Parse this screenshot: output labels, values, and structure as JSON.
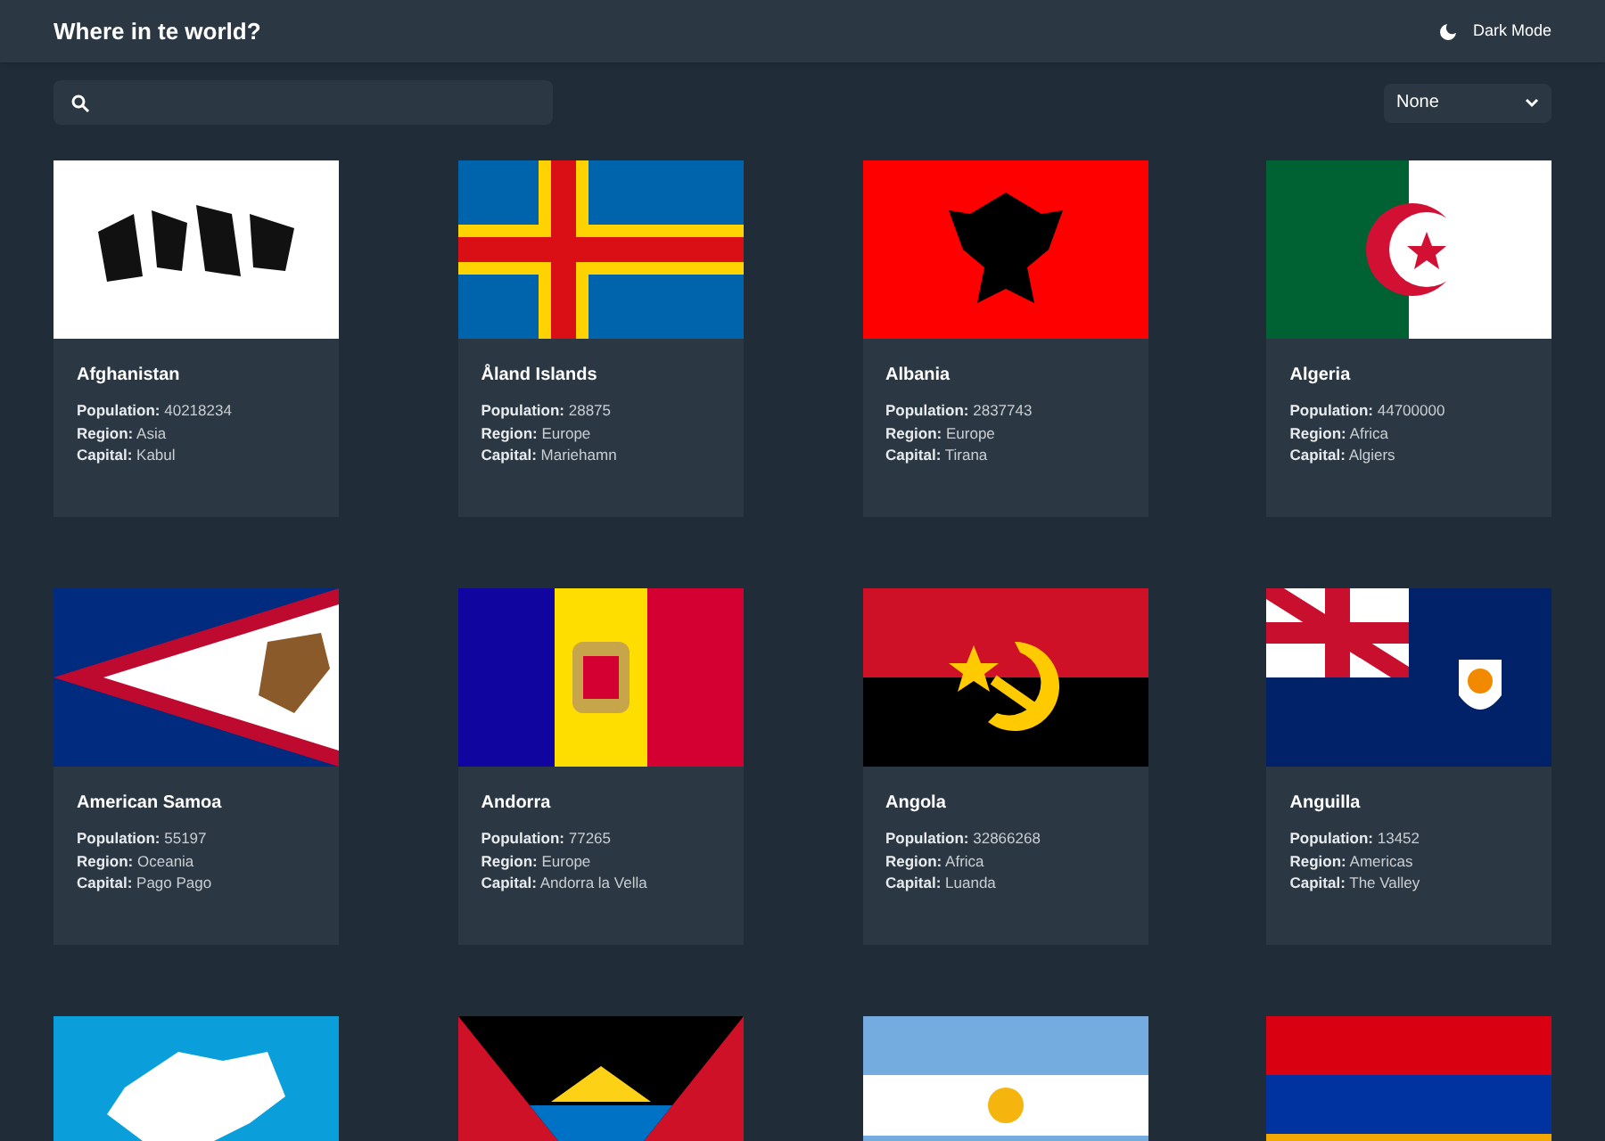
{
  "header": {
    "title": "Where in te world?",
    "theme_toggle": "Dark Mode"
  },
  "filter": {
    "value": "None"
  },
  "countries": [
    {
      "kind": "country",
      "name": "Afghanistan",
      "details": [
        "**Population:** 40218234",
        "**Region:** Asia",
        "**Capital:** Kabul"
      ]
    },
    {
      "kind": "country",
      "name": "Åland Islands",
      "details": [
        "**Population:** 28875",
        "**Region:** Europe",
        "**Capital:** Mariehamn"
      ]
    },
    {
      "kind": "country",
      "name": "Albania",
      "details": [
        "**Population:** 2837743",
        "**Region:** Europe",
        "**Capital:** Tirana"
      ]
    },
    {
      "kind": "country",
      "name": "Algeria",
      "details": [
        "**Population:** 44700000",
        "**Region:** Africa",
        "**Capital:** Algiers"
      ]
    },
    {
      "kind": "country",
      "name": "American Samoa",
      "details": [
        "**Population:** 55197",
        "**Region:** Oceania",
        "**Capital:** Pago Pago"
      ]
    },
    {
      "kind": "country",
      "name": "Andorra",
      "details": [
        "**Population:** 77265",
        "**Region:** Europe",
        "**Capital:** Andorra la Vella"
      ]
    },
    {
      "kind": "country",
      "name": "Angola",
      "details": [
        "**Population:** 32866268",
        "**Region:** Africa",
        "**Capital:** Luanda"
      ]
    },
    {
      "kind": "country",
      "name": "Anguilla",
      "details": [
        "**Population:** 13452",
        "**Region:** Americas",
        "**Capital:** The Valley"
      ]
    },
    {
      "kind": "picture"
    },
    {
      "kind": "picture"
    },
    {
      "kind": "picture"
    },
    {
      "kind": "picture"
    }
  ]
}
